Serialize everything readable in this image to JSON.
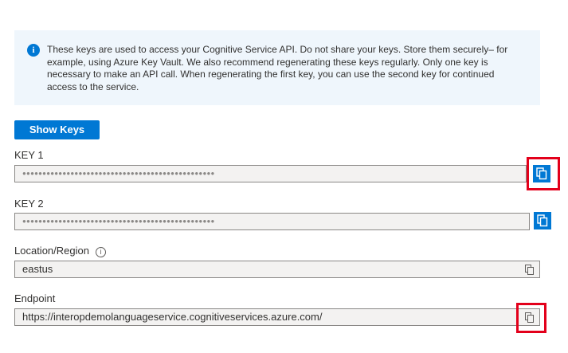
{
  "info": {
    "icon": "info-icon",
    "text": "These keys are used to access your Cognitive Service API. Do not share your keys. Store them securely– for example, using Azure Key Vault. We also recommend regenerating these keys regularly. Only one key is necessary to make an API call. When regenerating the first key, you can use the second key for continued access to the service."
  },
  "show_keys_label": "Show Keys",
  "key1": {
    "label": "KEY 1",
    "masked": "●●●●●●●●●●●●●●●●●●●●●●●●●●●●●●●●●●●●●●●●●●●●●●●●"
  },
  "key2": {
    "label": "KEY 2",
    "masked": "●●●●●●●●●●●●●●●●●●●●●●●●●●●●●●●●●●●●●●●●●●●●●●●●"
  },
  "location": {
    "label": "Location/Region",
    "value": "eastus"
  },
  "endpoint": {
    "label": "Endpoint",
    "value": "https://interopdemolanguageservice.cognitiveservices.azure.com/"
  },
  "colors": {
    "accent": "#0078d4",
    "highlight": "#e3001b",
    "info_background": "#eff6fc"
  }
}
